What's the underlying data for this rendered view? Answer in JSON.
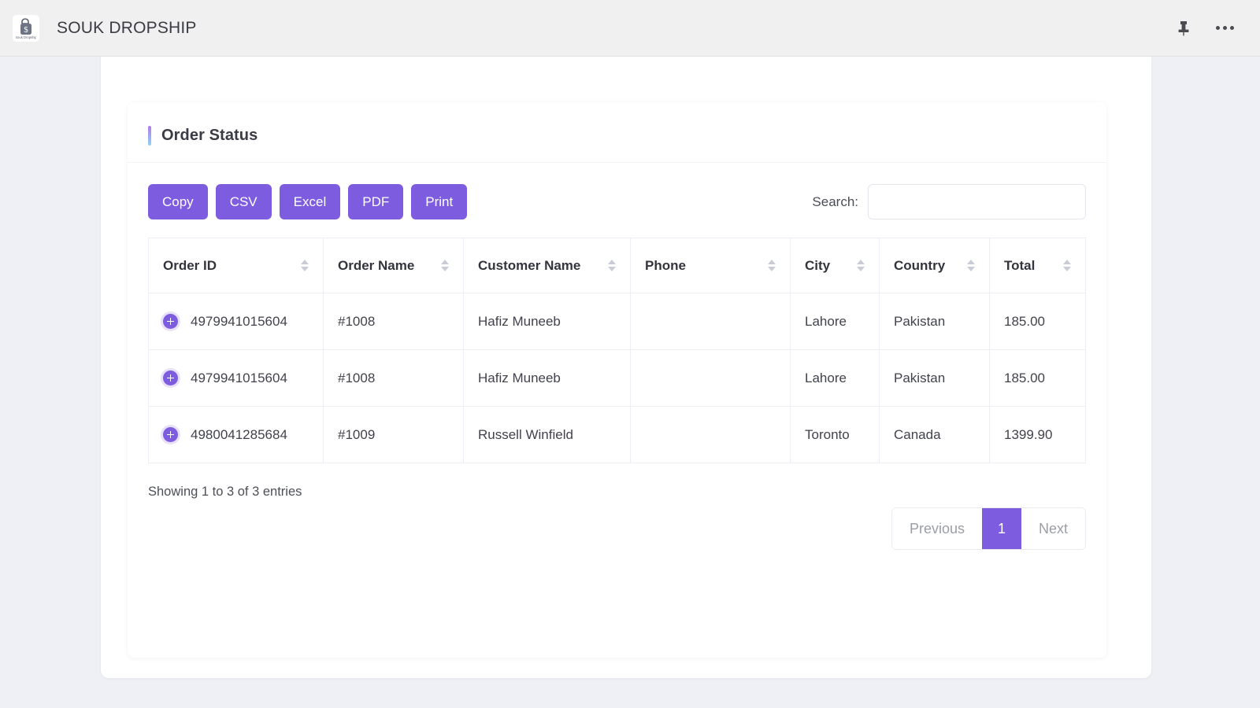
{
  "appbar": {
    "title": "SOUK DROPSHIP",
    "logo_alt": "souk-dropship-logo",
    "pin_icon": "pushpin-icon",
    "more_icon": "more-options-icon"
  },
  "panel": {
    "title": "Order Status"
  },
  "toolbar": {
    "buttons": [
      {
        "label": "Copy",
        "name": "copy-button"
      },
      {
        "label": "CSV",
        "name": "csv-button"
      },
      {
        "label": "Excel",
        "name": "excel-button"
      },
      {
        "label": "PDF",
        "name": "pdf-button"
      },
      {
        "label": "Print",
        "name": "print-button"
      }
    ],
    "search_label": "Search:",
    "search_value": "",
    "search_placeholder": ""
  },
  "table": {
    "columns": [
      {
        "label": "Order ID",
        "sortable": true
      },
      {
        "label": "Order Name",
        "sortable": true
      },
      {
        "label": "Customer Name",
        "sortable": true
      },
      {
        "label": "Phone",
        "sortable": true
      },
      {
        "label": "City",
        "sortable": true
      },
      {
        "label": "Country",
        "sortable": true
      },
      {
        "label": "Total",
        "sortable": true
      }
    ],
    "rows": [
      {
        "order_id": "4979941015604",
        "order_name": "#1008",
        "customer_name": "Hafiz Muneeb",
        "phone": "",
        "city": "Lahore",
        "country": "Pakistan",
        "total": "185.00"
      },
      {
        "order_id": "4979941015604",
        "order_name": "#1008",
        "customer_name": "Hafiz Muneeb",
        "phone": "",
        "city": "Lahore",
        "country": "Pakistan",
        "total": "185.00"
      },
      {
        "order_id": "4980041285684",
        "order_name": "#1009",
        "customer_name": "Russell Winfield",
        "phone": "",
        "city": "Toronto",
        "country": "Canada",
        "total": "1399.90"
      }
    ]
  },
  "footer": {
    "info": "Showing 1 to 3 of 3 entries",
    "pagination": {
      "previous": "Previous",
      "pages": [
        "1"
      ],
      "active_page": "1",
      "next": "Next"
    }
  },
  "colors": {
    "accent_purple": "#7d5ce0",
    "page_background": "#eef0f5",
    "appbar_background": "#f0f0f0",
    "card_background": "#ffffff",
    "text_primary": "#3a3b45",
    "text_muted": "#9b9da8"
  }
}
